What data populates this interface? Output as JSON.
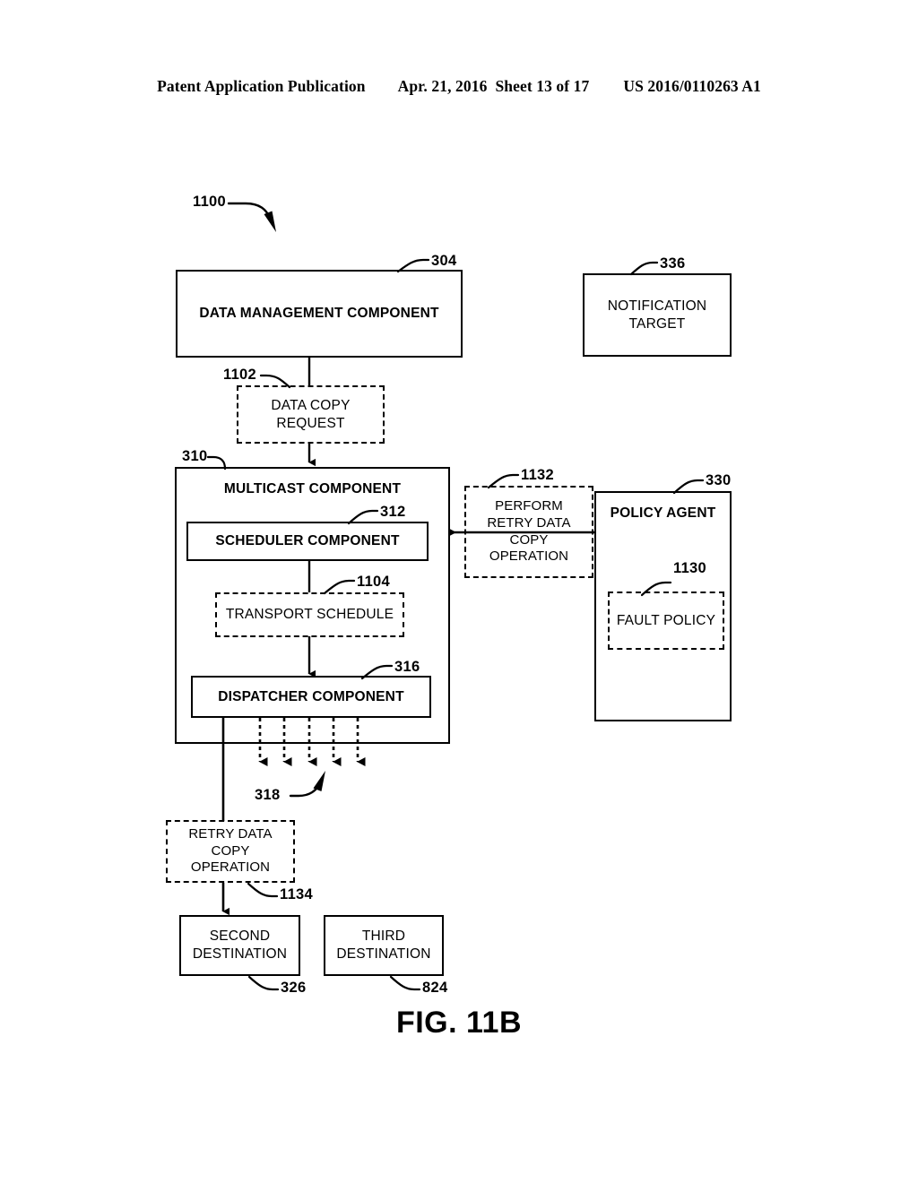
{
  "header": {
    "publication": "Patent Application Publication",
    "date": "Apr. 21, 2016",
    "sheet": "Sheet 13 of 17",
    "patent_number": "US 2016/0110263 A1"
  },
  "figure": {
    "caption": "FIG. 11B",
    "diagram_ref": "1100"
  },
  "nodes": {
    "data_management_component": {
      "label": "DATA MANAGEMENT COMPONENT",
      "ref": "304",
      "style": "solid"
    },
    "notification_target": {
      "label": "NOTIFICATION TARGET",
      "line1": "NOTIFICATION",
      "line2": "TARGET",
      "ref": "336",
      "style": "solid"
    },
    "data_copy_request": {
      "label": "DATA COPY REQUEST",
      "line1": "DATA COPY",
      "line2": "REQUEST",
      "ref": "1102",
      "style": "dashed"
    },
    "multicast_component": {
      "label": "MULTICAST COMPONENT",
      "ref": "310",
      "style": "solid"
    },
    "scheduler_component": {
      "label": "SCHEDULER COMPONENT",
      "ref": "312",
      "style": "solid"
    },
    "transport_schedule": {
      "label": "TRANSPORT SCHEDULE",
      "ref": "1104",
      "style": "dashed"
    },
    "dispatcher_component": {
      "label": "DISPATCHER COMPONENT",
      "ref": "316",
      "style": "solid"
    },
    "perform_retry_data_copy_operation": {
      "label": "PERFORM RETRY DATA COPY OPERATION",
      "line1": "PERFORM",
      "line2": "RETRY DATA",
      "line3": "COPY",
      "line4": "OPERATION",
      "ref": "1132",
      "style": "dashed"
    },
    "policy_agent": {
      "label": "POLICY AGENT",
      "ref": "330",
      "style": "solid"
    },
    "fault_policy": {
      "label": "FAULT POLICY",
      "ref": "1130",
      "style": "dashed"
    },
    "retry_data_copy_operation": {
      "label": "RETRY DATA COPY OPERATION",
      "line1": "RETRY DATA",
      "line2": "COPY",
      "line3": "OPERATION",
      "ref": "1134",
      "style": "dashed"
    },
    "second_destination": {
      "label": "SECOND DESTINATION",
      "line1": "SECOND",
      "line2": "DESTINATION",
      "ref": "326",
      "style": "solid"
    },
    "third_destination": {
      "label": "THIRD DESTINATION",
      "line1": "THIRD",
      "line2": "DESTINATION",
      "ref": "824",
      "style": "solid"
    },
    "multicast_output_arrows": {
      "ref": "318",
      "count": 5
    }
  },
  "colors": {
    "ink": "#000000",
    "paper": "#ffffff"
  }
}
